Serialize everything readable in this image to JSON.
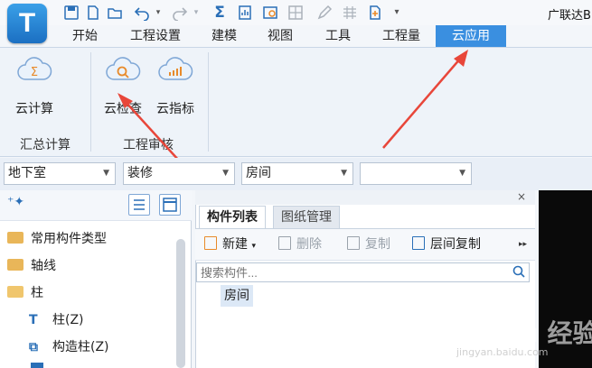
{
  "app": {
    "logo_letter": "T",
    "title": "广联达B"
  },
  "quick_access": {
    "more_glyph": "▾",
    "icons": [
      "save-icon",
      "new-doc-icon",
      "open-folder-icon",
      "undo-icon",
      "redo-icon",
      "sum-icon",
      "report-icon",
      "view-icon",
      "grid-icon",
      "pen-icon",
      "table-icon",
      "add-doc-icon"
    ]
  },
  "ribbon": {
    "tabs": [
      {
        "label": "开始"
      },
      {
        "label": "工程设置"
      },
      {
        "label": "建模"
      },
      {
        "label": "视图"
      },
      {
        "label": "工具"
      },
      {
        "label": "工程量"
      },
      {
        "label": "云应用",
        "active": true
      }
    ],
    "buttons": [
      {
        "label": "云计算",
        "icon": "cloud-sum-icon"
      },
      {
        "label": "云检查",
        "icon": "cloud-search-icon"
      },
      {
        "label": "云指标",
        "icon": "cloud-chart-icon"
      }
    ],
    "groups": [
      "汇总计算",
      "工程审核"
    ]
  },
  "filters": [
    {
      "value": "地下室"
    },
    {
      "value": "装修"
    },
    {
      "value": "房间"
    },
    {
      "value": ""
    }
  ],
  "tree": {
    "items": [
      {
        "label": "常用构件类型",
        "icon": "folder-icon"
      },
      {
        "label": "轴线",
        "icon": "folder-icon"
      },
      {
        "label": "柱",
        "icon": "folder-open-icon"
      },
      {
        "label": "柱(Z)",
        "icon": "column-icon"
      },
      {
        "label": "构造柱(Z)",
        "icon": "construct-column-icon"
      }
    ]
  },
  "components": {
    "tabs": [
      "构件列表",
      "图纸管理"
    ],
    "toolbar": [
      {
        "label": "新建",
        "dropdown": "▾",
        "enabled": true
      },
      {
        "label": "删除",
        "enabled": false
      },
      {
        "label": "复制",
        "enabled": false
      },
      {
        "label": "层间复制",
        "enabled": true
      }
    ],
    "more_glyph": "▸▸",
    "search_placeholder": "搜索构件...",
    "items": [
      "房间"
    ],
    "close_glyph": "×"
  },
  "watermark": {
    "text": "Baidu 经验",
    "sub": "jingyan.baidu.com"
  },
  "colors": {
    "accent": "#3a8fe0",
    "arrow": "#e8463a"
  }
}
